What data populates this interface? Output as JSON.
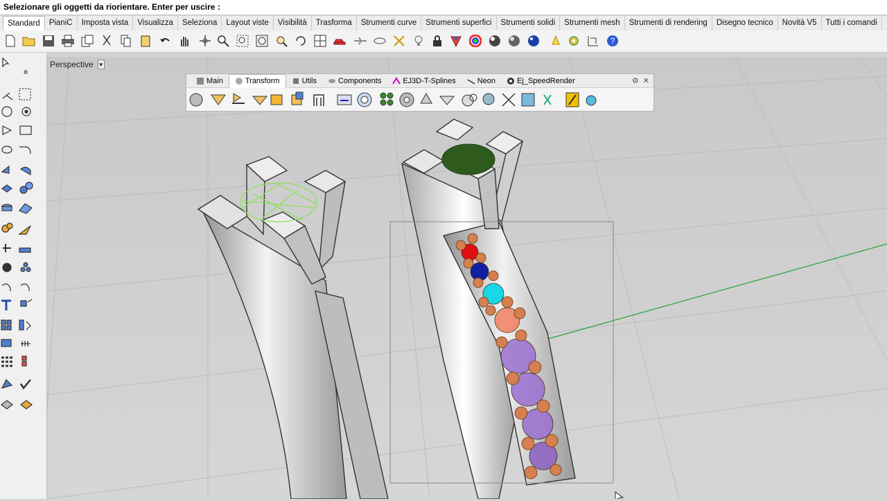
{
  "command_prompt": "Selezionare gli oggetti da riorientare. Enter per uscire :",
  "tabs": [
    "Standard",
    "PianiC",
    "Imposta vista",
    "Visualizza",
    "Seleziona",
    "Layout viste",
    "Visibilità",
    "Trasforma",
    "Strumenti curve",
    "Strumenti superfici",
    "Strumenti solidi",
    "Strumenti mesh",
    "Strumenti di rendering",
    "Disegno tecnico",
    "Novità V5",
    "Tutti i comandi"
  ],
  "active_tab": "Standard",
  "viewport": {
    "name": "Perspective"
  },
  "floating_toolbar": {
    "tabs": [
      "Main",
      "Transform",
      "Utils",
      "Components",
      "EJ3D-T-Splines",
      "Neon",
      "Ej_SpeedRender"
    ],
    "active": "Transform"
  },
  "colors": {
    "accent_green": "#1fa33a",
    "grid": "#bcbcbc",
    "ring_metal": "#b9b9b9",
    "selection": "#888888"
  }
}
